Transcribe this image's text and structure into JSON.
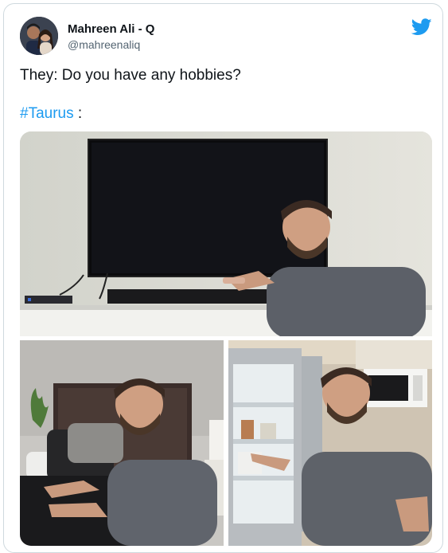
{
  "tweet": {
    "author_name": "Mahreen Ali - Q",
    "author_handle": "@mahreenaliq",
    "line1": "They: Do you have any hobbies?",
    "hashtag": "#Taurus",
    "line2_suffix": " :",
    "brand_icon": "twitter-bird-icon",
    "brand_color": "#1d9bf0"
  },
  "media": {
    "photos": [
      {
        "subject": "tv-photo"
      },
      {
        "subject": "bed-photo"
      },
      {
        "subject": "fridge-photo"
      }
    ]
  }
}
